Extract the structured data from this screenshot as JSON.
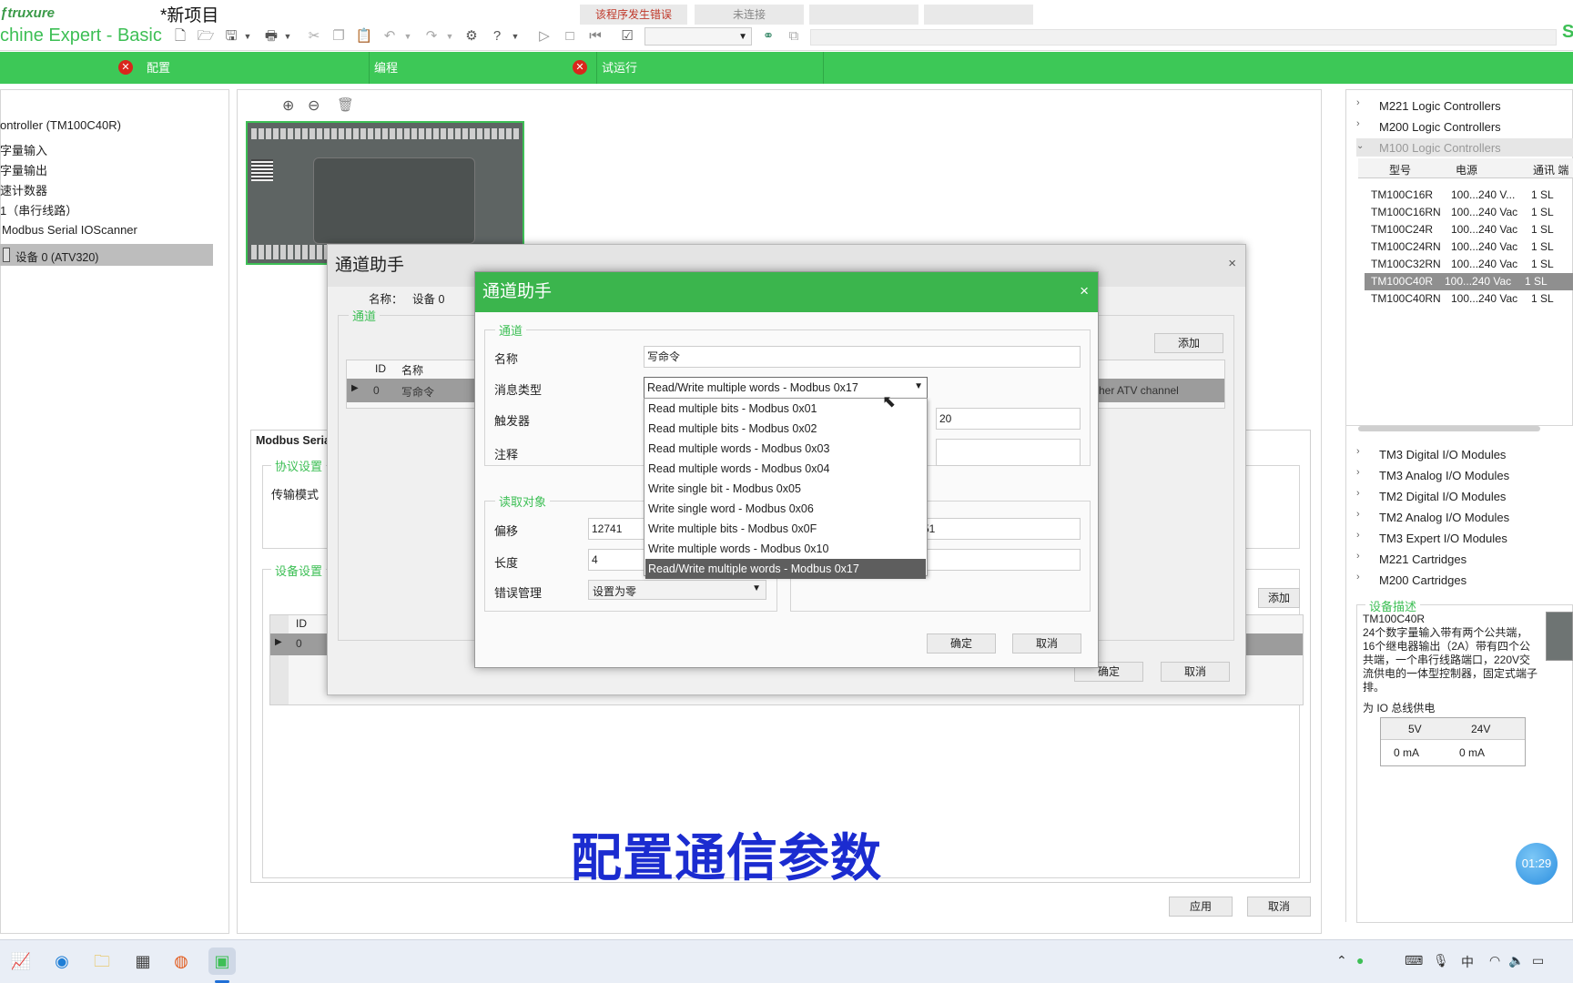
{
  "app": {
    "logo": "truxure",
    "name": "chine Expert - Basic",
    "project": "*新项目"
  },
  "status": {
    "error": "该程序发生错误",
    "connection": "未连接"
  },
  "tabs": {
    "config": "配置",
    "program": "编程",
    "commission": "试运行"
  },
  "tree": {
    "controller": "ontroller (TM100C40R)",
    "digital_in": "字量输入",
    "digital_out": "字量输出",
    "hs_counter": "速计数器",
    "serial": "1（串行线路）",
    "ioscanner": "Modbus Serial IOScanner",
    "device": "设备 0 (ATV320)"
  },
  "catalog": {
    "m221": "M221 Logic Controllers",
    "m200": "M200 Logic Controllers",
    "m100": "M100 Logic Controllers",
    "headers": [
      "型号",
      "电源",
      "通讯 端"
    ],
    "rows": [
      [
        "TM100C16R",
        "100...240 V...",
        "1 SL"
      ],
      [
        "TM100C16RN",
        "100...240 Vac",
        "1 SL"
      ],
      [
        "TM100C24R",
        "100...240 Vac",
        "1 SL"
      ],
      [
        "TM100C24RN",
        "100...240 Vac",
        "1 SL"
      ],
      [
        "TM100C32RN",
        "100...240 Vac",
        "1 SL"
      ],
      [
        "TM100C40R",
        "100...240 Vac",
        "1 SL"
      ],
      [
        "TM100C40RN",
        "100...240 Vac",
        "1 SL"
      ]
    ],
    "modules": [
      "TM3 Digital I/O Modules",
      "TM3 Analog I/O Modules",
      "TM2 Digital I/O Modules",
      "TM2 Analog I/O Modules",
      "TM3 Expert I/O Modules",
      "M221 Cartridges",
      "M200 Cartridges"
    ],
    "desc_title": "设备描述",
    "desc_model": "TM100C40R",
    "desc_text": [
      "24个数字量输入带有两个公共端，",
      "16个继电器输出（2A）带有四个公",
      "共端，一个串行线路端口，220V交",
      "流供电的一体型控制器，固定式端子",
      "排。"
    ],
    "io_power": "为 IO 总线供电",
    "power_headers": [
      "5V",
      "24V"
    ],
    "power_values": [
      "0 mA",
      "0 mA"
    ]
  },
  "modbus": {
    "title": "Modbus Seria",
    "protocol": "协议设置",
    "tx_mode": "传输模式",
    "device_settings": "设备设置",
    "id_header": "ID",
    "id_value": "0",
    "add": "添加",
    "apply": "应用",
    "cancel": "取消"
  },
  "dlg1": {
    "title": "通道助手",
    "name_label": "名称：",
    "name_value": "设备 0",
    "channels": "通道",
    "col_id": "ID",
    "col_name": "名称",
    "row_id": "0",
    "row_name": "写命令",
    "row_desc": "her ATV channel",
    "add": "添加",
    "ok": "确定",
    "cancel": "取消"
  },
  "dlg2": {
    "title": "通道助手",
    "group": "通道",
    "name_label": "名称",
    "name_value": "写命令",
    "msgtype_label": "消息类型",
    "msgtype_value": "Read/Write multiple words - Modbus 0x17",
    "trigger_label": "触发器",
    "trigger_value": "20",
    "comment_label": "注释",
    "read_group": "读取对象",
    "offset_label": "偏移",
    "offset_value": "12741",
    "length_label": "长度",
    "length_value": "4",
    "write_offset_partial": "51",
    "error_label": "错误管理",
    "error_value": "设置为零",
    "ok": "确定",
    "cancel": "取消",
    "options": [
      "Read multiple bits - Modbus 0x01",
      "Read multiple bits - Modbus 0x02",
      "Read multiple words - Modbus 0x03",
      "Read multiple words - Modbus 0x04",
      "Write single bit - Modbus 0x05",
      "Write single word - Modbus 0x06",
      "Write multiple bits - Modbus 0x0F",
      "Write multiple words - Modbus 0x10",
      "Read/Write multiple words - Modbus 0x17"
    ]
  },
  "caption": "配置通信参数",
  "timer": "01:29",
  "tray": {
    "ime": "中"
  }
}
